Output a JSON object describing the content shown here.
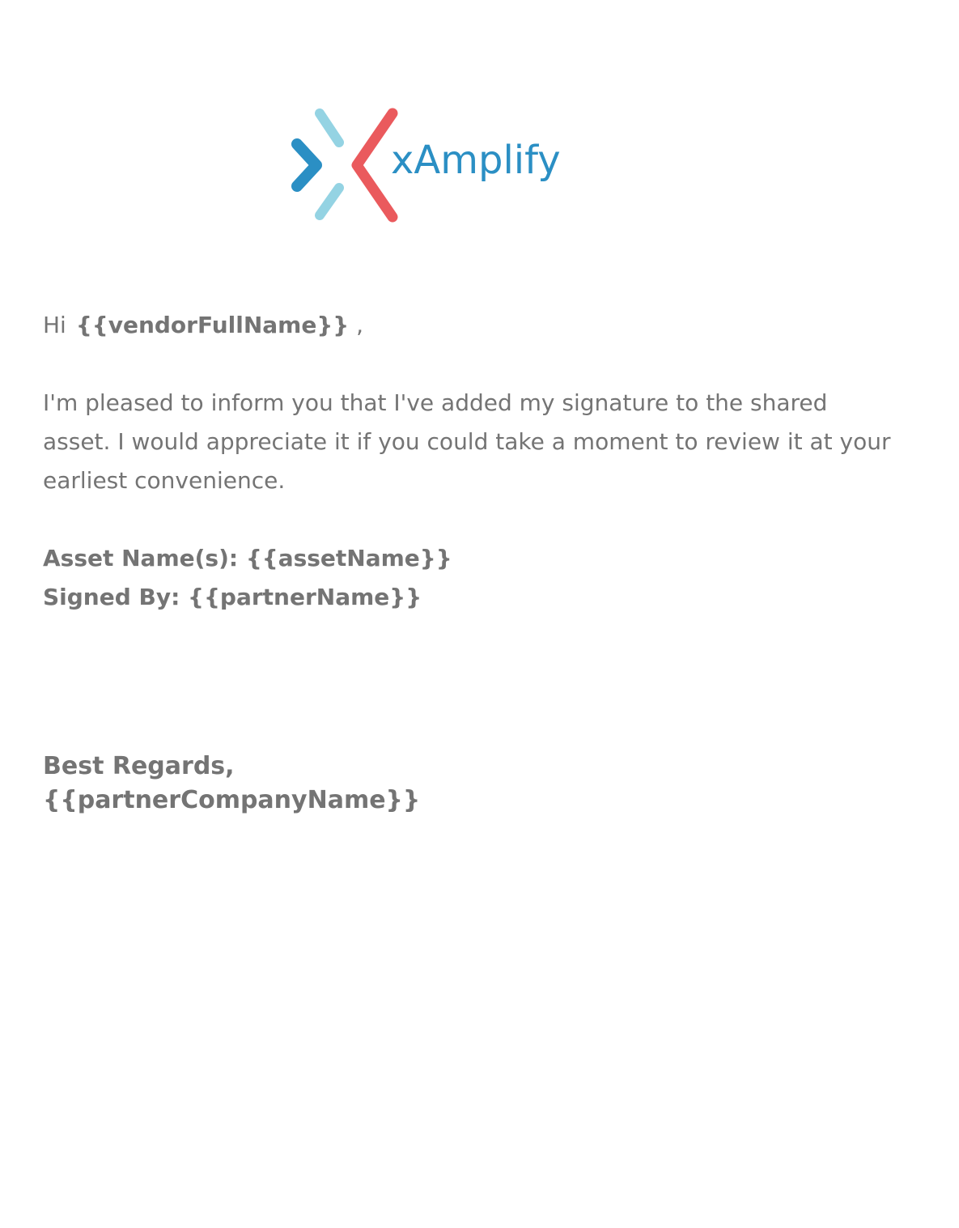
{
  "logo": {
    "text": "xAmplify",
    "colors": {
      "text": "#2b8fc4",
      "dark_blue": "#2b8fc4",
      "light_blue": "#94d3e3",
      "red": "#ea5a5d"
    }
  },
  "email": {
    "greeting_prefix": "Hi",
    "greeting_name": "{{vendorFullName}}",
    "greeting_suffix": " ,",
    "body": "I'm pleased to inform you that I've added my signature to the shared asset. I would appreciate it if you could take a moment to review it at your earliest convenience.",
    "asset_line": "Asset Name(s): {{assetName}}",
    "signed_line": "Signed By: {{partnerName}}",
    "closing": "Best Regards,",
    "company": "{{partnerCompanyName}}"
  },
  "colors": {
    "text": "#747474",
    "background": "#ffffff"
  }
}
